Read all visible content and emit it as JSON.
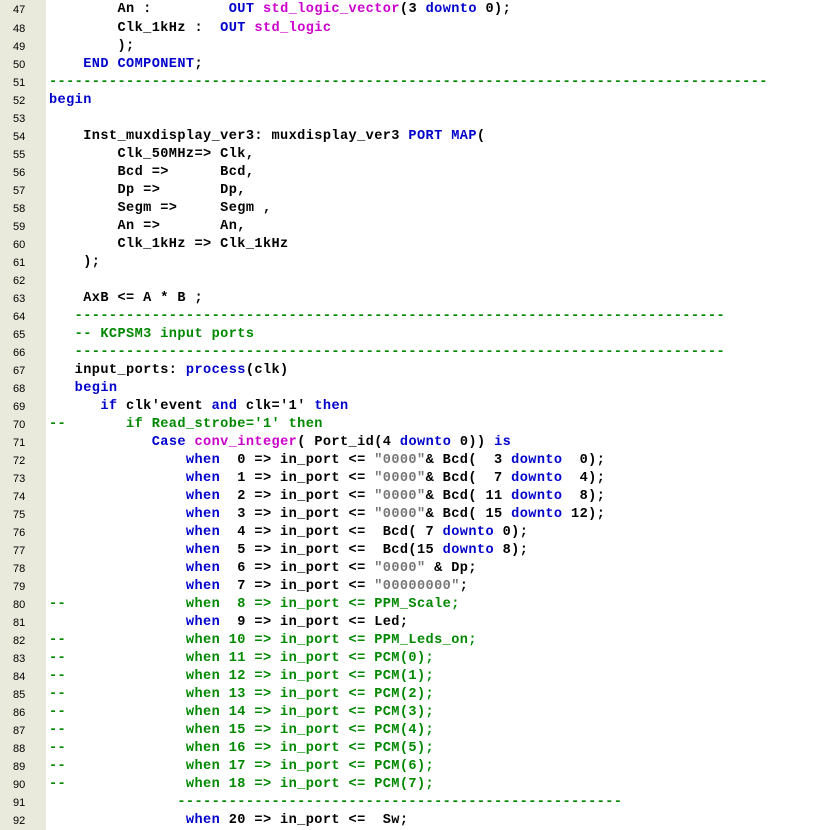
{
  "colors": {
    "gutter_bg": "#e9e9dc",
    "editor_bg": "#ffffff",
    "keyword": "#0000cc",
    "type": "#cc00cc",
    "string": "#777777",
    "comment": "#008800",
    "plain": "#000000"
  },
  "lines": [
    {
      "num": "47",
      "tokens": [
        {
          "t": "pl",
          "s": "        An :         "
        },
        {
          "t": "kw",
          "s": "OUT"
        },
        {
          "t": "pl",
          "s": " "
        },
        {
          "t": "ty",
          "s": "std_logic_vector"
        },
        {
          "t": "pl",
          "s": "(3 "
        },
        {
          "t": "kw",
          "s": "downto"
        },
        {
          "t": "pl",
          "s": " 0);"
        }
      ]
    },
    {
      "num": "48",
      "tokens": [
        {
          "t": "pl",
          "s": "        Clk_1kHz :  "
        },
        {
          "t": "kw",
          "s": "OUT"
        },
        {
          "t": "pl",
          "s": " "
        },
        {
          "t": "ty",
          "s": "std_logic"
        }
      ]
    },
    {
      "num": "49",
      "tokens": [
        {
          "t": "pl",
          "s": "        );"
        }
      ]
    },
    {
      "num": "50",
      "tokens": [
        {
          "t": "pl",
          "s": "    "
        },
        {
          "t": "kw",
          "s": "END COMPONENT"
        },
        {
          "t": "pl",
          "s": ";"
        }
      ]
    },
    {
      "num": "51",
      "tokens": [
        {
          "t": "cm",
          "s": "------------------------------------------------------------------------------------"
        }
      ]
    },
    {
      "num": "52",
      "tokens": [
        {
          "t": "kw",
          "s": "begin"
        }
      ]
    },
    {
      "num": "53",
      "tokens": []
    },
    {
      "num": "54",
      "tokens": [
        {
          "t": "pl",
          "s": "    Inst_muxdisplay_ver3: muxdisplay_ver3 "
        },
        {
          "t": "kw",
          "s": "PORT MAP"
        },
        {
          "t": "pl",
          "s": "("
        }
      ]
    },
    {
      "num": "55",
      "tokens": [
        {
          "t": "pl",
          "s": "        Clk_50MHz=> Clk,"
        }
      ]
    },
    {
      "num": "56",
      "tokens": [
        {
          "t": "pl",
          "s": "        Bcd =>      Bcd,"
        }
      ]
    },
    {
      "num": "57",
      "tokens": [
        {
          "t": "pl",
          "s": "        Dp =>       Dp,"
        }
      ]
    },
    {
      "num": "58",
      "tokens": [
        {
          "t": "pl",
          "s": "        Segm =>     Segm ,"
        }
      ]
    },
    {
      "num": "59",
      "tokens": [
        {
          "t": "pl",
          "s": "        An =>       An,"
        }
      ]
    },
    {
      "num": "60",
      "tokens": [
        {
          "t": "pl",
          "s": "        Clk_1kHz => Clk_1kHz"
        }
      ]
    },
    {
      "num": "61",
      "tokens": [
        {
          "t": "pl",
          "s": "    );"
        }
      ]
    },
    {
      "num": "62",
      "tokens": []
    },
    {
      "num": "63",
      "tokens": [
        {
          "t": "pl",
          "s": "    AxB <= A * B ;"
        }
      ]
    },
    {
      "num": "64",
      "tokens": [
        {
          "t": "cm",
          "s": "   ----------------------------------------------------------------------------"
        }
      ]
    },
    {
      "num": "65",
      "tokens": [
        {
          "t": "cm",
          "s": "   -- KCPSM3 input ports"
        }
      ]
    },
    {
      "num": "66",
      "tokens": [
        {
          "t": "cm",
          "s": "   ----------------------------------------------------------------------------"
        }
      ]
    },
    {
      "num": "67",
      "tokens": [
        {
          "t": "pl",
          "s": "   input_ports: "
        },
        {
          "t": "kw",
          "s": "process"
        },
        {
          "t": "pl",
          "s": "(clk)"
        }
      ]
    },
    {
      "num": "68",
      "tokens": [
        {
          "t": "kw",
          "s": "   begin"
        }
      ]
    },
    {
      "num": "69",
      "tokens": [
        {
          "t": "pl",
          "s": "      "
        },
        {
          "t": "kw",
          "s": "if"
        },
        {
          "t": "pl",
          "s": " clk'event "
        },
        {
          "t": "kw",
          "s": "and"
        },
        {
          "t": "pl",
          "s": " clk='1' "
        },
        {
          "t": "kw",
          "s": "then"
        }
      ]
    },
    {
      "num": "70",
      "tokens": [
        {
          "t": "cm",
          "s": "--       if Read_strobe='1' then"
        }
      ]
    },
    {
      "num": "71",
      "tokens": [
        {
          "t": "pl",
          "s": "            "
        },
        {
          "t": "kw",
          "s": "Case"
        },
        {
          "t": "pl",
          "s": " "
        },
        {
          "t": "ty",
          "s": "conv_integer"
        },
        {
          "t": "pl",
          "s": "( Port_id(4 "
        },
        {
          "t": "kw",
          "s": "downto"
        },
        {
          "t": "pl",
          "s": " 0)) "
        },
        {
          "t": "kw",
          "s": "is"
        }
      ]
    },
    {
      "num": "72",
      "tokens": [
        {
          "t": "pl",
          "s": "                "
        },
        {
          "t": "kw",
          "s": "when"
        },
        {
          "t": "pl",
          "s": "  0 => in_port <= "
        },
        {
          "t": "st",
          "s": "\"0000\""
        },
        {
          "t": "pl",
          "s": "& Bcd(  3 "
        },
        {
          "t": "kw",
          "s": "downto"
        },
        {
          "t": "pl",
          "s": "  0);"
        }
      ]
    },
    {
      "num": "73",
      "tokens": [
        {
          "t": "pl",
          "s": "                "
        },
        {
          "t": "kw",
          "s": "when"
        },
        {
          "t": "pl",
          "s": "  1 => in_port <= "
        },
        {
          "t": "st",
          "s": "\"0000\""
        },
        {
          "t": "pl",
          "s": "& Bcd(  7 "
        },
        {
          "t": "kw",
          "s": "downto"
        },
        {
          "t": "pl",
          "s": "  4);"
        }
      ]
    },
    {
      "num": "74",
      "tokens": [
        {
          "t": "pl",
          "s": "                "
        },
        {
          "t": "kw",
          "s": "when"
        },
        {
          "t": "pl",
          "s": "  2 => in_port <= "
        },
        {
          "t": "st",
          "s": "\"0000\""
        },
        {
          "t": "pl",
          "s": "& Bcd( 11 "
        },
        {
          "t": "kw",
          "s": "downto"
        },
        {
          "t": "pl",
          "s": "  8);"
        }
      ]
    },
    {
      "num": "75",
      "tokens": [
        {
          "t": "pl",
          "s": "                "
        },
        {
          "t": "kw",
          "s": "when"
        },
        {
          "t": "pl",
          "s": "  3 => in_port <= "
        },
        {
          "t": "st",
          "s": "\"0000\""
        },
        {
          "t": "pl",
          "s": "& Bcd( 15 "
        },
        {
          "t": "kw",
          "s": "downto"
        },
        {
          "t": "pl",
          "s": " 12);"
        }
      ]
    },
    {
      "num": "76",
      "tokens": [
        {
          "t": "pl",
          "s": "                "
        },
        {
          "t": "kw",
          "s": "when"
        },
        {
          "t": "pl",
          "s": "  4 => in_port <=  Bcd( 7 "
        },
        {
          "t": "kw",
          "s": "downto"
        },
        {
          "t": "pl",
          "s": " 0);"
        }
      ]
    },
    {
      "num": "77",
      "tokens": [
        {
          "t": "pl",
          "s": "                "
        },
        {
          "t": "kw",
          "s": "when"
        },
        {
          "t": "pl",
          "s": "  5 => in_port <=  Bcd(15 "
        },
        {
          "t": "kw",
          "s": "downto"
        },
        {
          "t": "pl",
          "s": " 8);"
        }
      ]
    },
    {
      "num": "78",
      "tokens": [
        {
          "t": "pl",
          "s": "                "
        },
        {
          "t": "kw",
          "s": "when"
        },
        {
          "t": "pl",
          "s": "  6 => in_port <= "
        },
        {
          "t": "st",
          "s": "\"0000\""
        },
        {
          "t": "pl",
          "s": " & Dp;"
        }
      ]
    },
    {
      "num": "79",
      "tokens": [
        {
          "t": "pl",
          "s": "                "
        },
        {
          "t": "kw",
          "s": "when"
        },
        {
          "t": "pl",
          "s": "  7 => in_port <= "
        },
        {
          "t": "st",
          "s": "\"00000000\""
        },
        {
          "t": "pl",
          "s": ";"
        }
      ]
    },
    {
      "num": "80",
      "tokens": [
        {
          "t": "cm",
          "s": "--              when  8 => in_port <= PPM_Scale;"
        }
      ]
    },
    {
      "num": "81",
      "tokens": [
        {
          "t": "pl",
          "s": "                "
        },
        {
          "t": "kw",
          "s": "when"
        },
        {
          "t": "pl",
          "s": "  9 => in_port <= Led;"
        }
      ]
    },
    {
      "num": "82",
      "tokens": [
        {
          "t": "cm",
          "s": "--              when 10 => in_port <= PPM_Leds_on;"
        }
      ]
    },
    {
      "num": "83",
      "tokens": [
        {
          "t": "cm",
          "s": "--              when 11 => in_port <= PCM(0);"
        }
      ]
    },
    {
      "num": "84",
      "tokens": [
        {
          "t": "cm",
          "s": "--              when 12 => in_port <= PCM(1);"
        }
      ]
    },
    {
      "num": "85",
      "tokens": [
        {
          "t": "cm",
          "s": "--              when 13 => in_port <= PCM(2);"
        }
      ]
    },
    {
      "num": "86",
      "tokens": [
        {
          "t": "cm",
          "s": "--              when 14 => in_port <= PCM(3);"
        }
      ]
    },
    {
      "num": "87",
      "tokens": [
        {
          "t": "cm",
          "s": "--              when 15 => in_port <= PCM(4);"
        }
      ]
    },
    {
      "num": "88",
      "tokens": [
        {
          "t": "cm",
          "s": "--              when 16 => in_port <= PCM(5);"
        }
      ]
    },
    {
      "num": "89",
      "tokens": [
        {
          "t": "cm",
          "s": "--              when 17 => in_port <= PCM(6);"
        }
      ]
    },
    {
      "num": "90",
      "tokens": [
        {
          "t": "cm",
          "s": "--              when 18 => in_port <= PCM(7);"
        }
      ]
    },
    {
      "num": "91",
      "tokens": [
        {
          "t": "cm",
          "s": "               ----------------------------------------------------"
        }
      ]
    },
    {
      "num": "92",
      "tokens": [
        {
          "t": "pl",
          "s": "                "
        },
        {
          "t": "kw",
          "s": "when"
        },
        {
          "t": "pl",
          "s": " 20 => in_port <=  Sw;"
        }
      ]
    }
  ]
}
